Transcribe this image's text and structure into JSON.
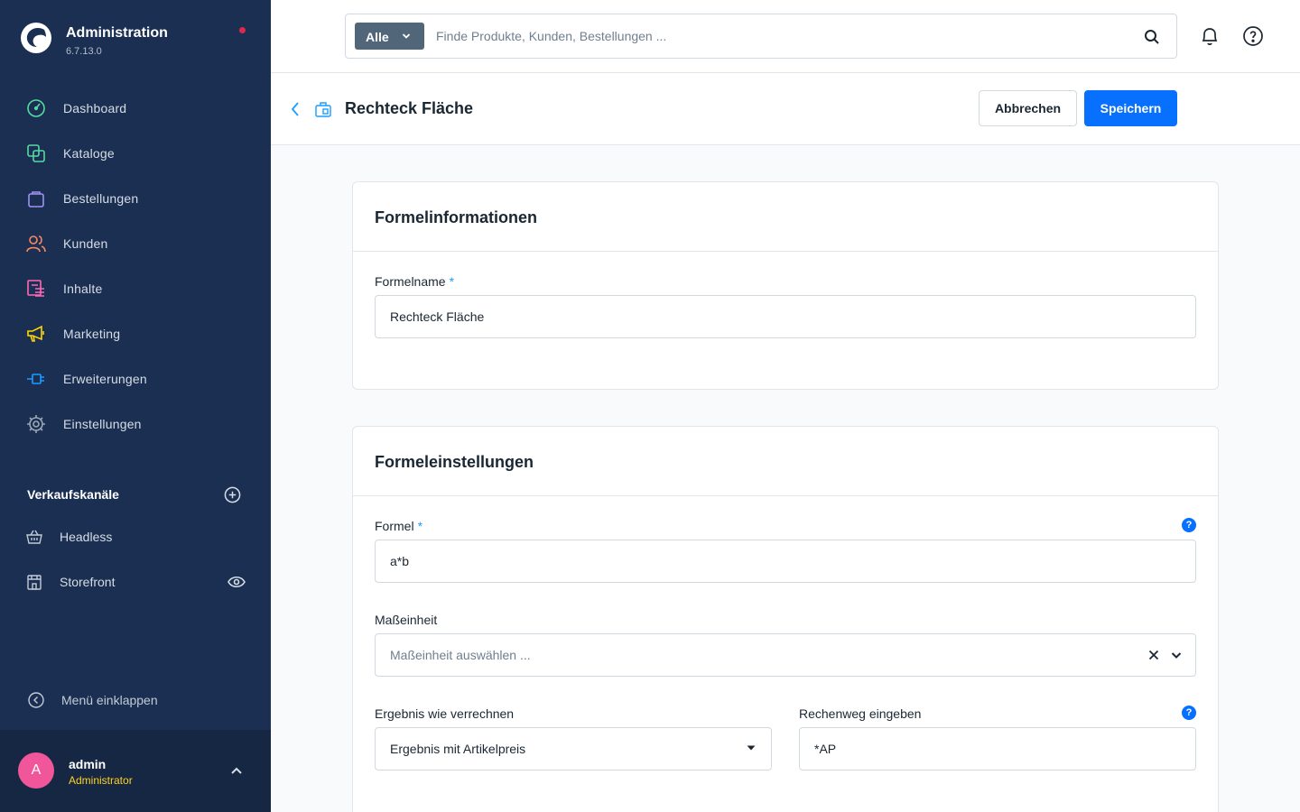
{
  "app": {
    "title": "Administration",
    "version": "6.7.13.0"
  },
  "sidebar": {
    "items": [
      {
        "label": "Dashboard",
        "icon": "dashboard-icon",
        "color": "#57d9a3"
      },
      {
        "label": "Kataloge",
        "icon": "catalog-icon",
        "color": "#57d9a3"
      },
      {
        "label": "Bestellungen",
        "icon": "shopping-bag-icon",
        "color": "#a092f0"
      },
      {
        "label": "Kunden",
        "icon": "users-icon",
        "color": "#f88962"
      },
      {
        "label": "Inhalte",
        "icon": "content-icon",
        "color": "#ff68b4"
      },
      {
        "label": "Marketing",
        "icon": "megaphone-icon",
        "color": "#ffd700"
      },
      {
        "label": "Erweiterungen",
        "icon": "plug-icon",
        "color": "#189eff"
      },
      {
        "label": "Einstellungen",
        "icon": "gear-icon",
        "color": "#9aa8b5"
      }
    ],
    "channels_title": "Verkaufskanäle",
    "channels": [
      {
        "label": "Headless",
        "icon": "basket-icon"
      },
      {
        "label": "Storefront",
        "icon": "storefront-icon"
      }
    ],
    "collapse_label": "Menü einklappen"
  },
  "user": {
    "initial": "A",
    "name": "admin",
    "role": "Administrator"
  },
  "search": {
    "type_label": "Alle",
    "placeholder": "Finde Produkte, Kunden, Bestellungen ..."
  },
  "smartbar": {
    "title": "Rechteck Fläche",
    "cancel_label": "Abbrechen",
    "save_label": "Speichern"
  },
  "card_info": {
    "title": "Formelinformationen",
    "name_label": "Formelname",
    "required_mark": "*",
    "name_value": "Rechteck Fläche"
  },
  "card_settings": {
    "title": "Formeleinstellungen",
    "formula_label": "Formel",
    "required_mark": "*",
    "formula_value": "a*b",
    "unit_label": "Maßeinheit",
    "unit_placeholder": "Maßeinheit auswählen ...",
    "result_label": "Ergebnis wie verrechnen",
    "result_value": "Ergebnis mit Artikelpreis",
    "calc_label": "Rechenweg eingeben",
    "calc_value": "*AP",
    "help_mark": "?"
  },
  "colors": {
    "sidebar_bg": "#1b2f52",
    "primary": "#0870ff",
    "avatar": "#f2569a",
    "role": "#ffd21f",
    "notification_dot": "#de294c"
  }
}
